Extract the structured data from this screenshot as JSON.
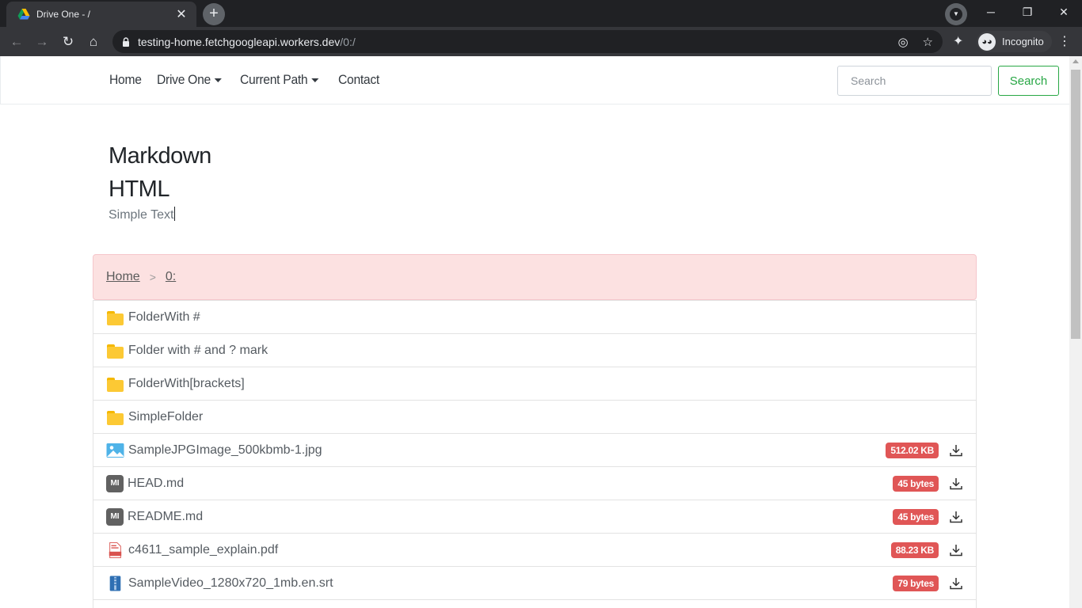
{
  "browser": {
    "tab_title": "Drive One - /",
    "url_host": "testing-home.fetchgoogleapi.workers.dev",
    "url_path": "/0:/",
    "profile_label": "Incognito"
  },
  "nav": {
    "links": [
      "Home",
      "Drive One",
      "Current Path",
      "Contact"
    ],
    "search_placeholder": "Search",
    "search_button": "Search"
  },
  "readme": {
    "heading_markdown": "Markdown",
    "heading_html": "HTML",
    "simple_text": "Simple Text"
  },
  "breadcrumb": {
    "items": [
      "Home",
      "0:"
    ],
    "separator": ">"
  },
  "files": [
    {
      "name": "FolderWith #",
      "type": "folder",
      "size": ""
    },
    {
      "name": "Folder with # and ? mark",
      "type": "folder",
      "size": ""
    },
    {
      "name": "FolderWith[brackets]",
      "type": "folder",
      "size": ""
    },
    {
      "name": "SimpleFolder",
      "type": "folder",
      "size": ""
    },
    {
      "name": "SampleJPGImage_500kbmb-1.jpg",
      "type": "image",
      "size": "512.02 KB"
    },
    {
      "name": "HEAD.md",
      "type": "markdown",
      "size": "45 bytes"
    },
    {
      "name": "README.md",
      "type": "markdown",
      "size": "45 bytes"
    },
    {
      "name": "c4611_sample_explain.pdf",
      "type": "pdf",
      "size": "88.23 KB"
    },
    {
      "name": "SampleVideo_1280x720_1mb.en.srt",
      "type": "subtitle",
      "size": "79 bytes"
    }
  ],
  "colors": {
    "accent_green": "#28a745",
    "breadcrumb_bg": "#fce1e1",
    "badge_red": "#e05656"
  }
}
